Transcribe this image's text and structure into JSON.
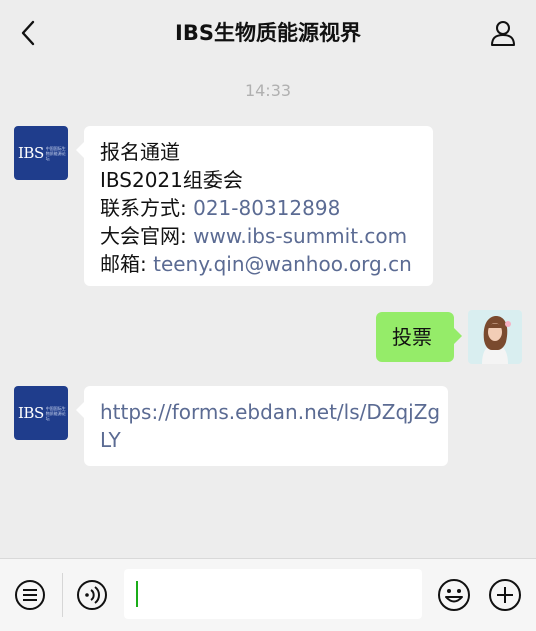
{
  "header": {
    "title": "IBS生物质能源视界"
  },
  "conversation": {
    "timestamp": "14:33",
    "messages": [
      {
        "from": "IBS",
        "lines": [
          {
            "label": "报名通道",
            "value": ""
          },
          {
            "label": "IBS2021组委会",
            "value": ""
          },
          {
            "label": "联系方式: ",
            "value": "021-80312898"
          },
          {
            "label": "大会官网: ",
            "value": "www.ibs-summit.com"
          },
          {
            "label": "邮箱: ",
            "value": "teeny.qin@wanhoo.org.cn"
          }
        ]
      },
      {
        "from": "me",
        "text": "投票"
      },
      {
        "from": "IBS",
        "lines": [
          {
            "value": "https://forms.ebdan.net/ls/DZqjZg"
          },
          {
            "value": "LY"
          }
        ]
      }
    ]
  },
  "avatar_ibs": {
    "logo_text": "IBS",
    "sub_text": "中国国际生物质能源论坛"
  },
  "colors": {
    "background": "#ededed",
    "bubble_incoming": "#ffffff",
    "bubble_outgoing": "#95ec69",
    "link": "#5b6b93",
    "ibs_blue": "#1f3d8c"
  },
  "icons": [
    "back-arrow-icon",
    "profile-icon",
    "menu-list-icon",
    "voice-icon",
    "emoji-icon",
    "plus-icon"
  ]
}
